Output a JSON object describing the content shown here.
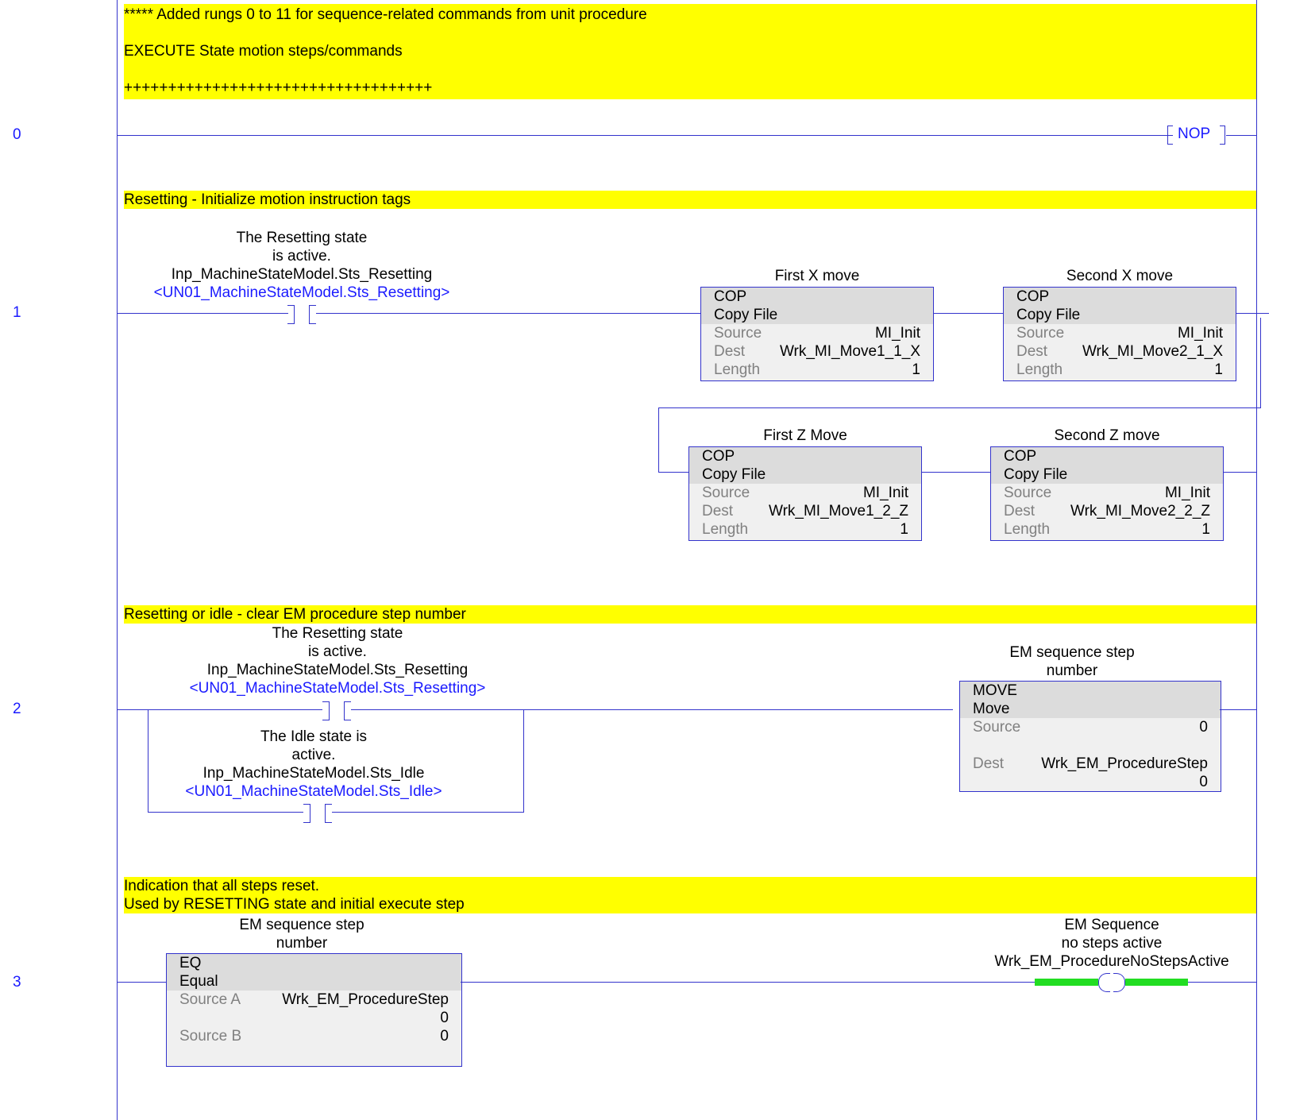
{
  "rungs": [
    {
      "number": "0",
      "comment": [
        "***** Added rungs 0 to 11 for sequence-related commands from unit procedure",
        "",
        "EXECUTE State motion steps/commands",
        "",
        "+++++++++++++++++++++++++++++++++++"
      ],
      "instruction": "NOP"
    },
    {
      "number": "1",
      "comment": [
        "Resetting - Initialize motion instruction tags"
      ],
      "contact": {
        "desc1": "The Resetting state",
        "desc2": "is active.",
        "tag": "Inp_MachineStateModel.Sts_Resetting",
        "alias": "<UN01_MachineStateModel.Sts_Resetting>"
      },
      "cop_blocks": [
        {
          "title": "First X move",
          "mnemonic": "COP",
          "name": "Copy File",
          "source_label": "Source",
          "source": "MI_Init",
          "dest_label": "Dest",
          "dest": "Wrk_MI_Move1_1_X",
          "length_label": "Length",
          "length": "1"
        },
        {
          "title": "Second X move",
          "mnemonic": "COP",
          "name": "Copy File",
          "source_label": "Source",
          "source": "MI_Init",
          "dest_label": "Dest",
          "dest": "Wrk_MI_Move2_1_X",
          "length_label": "Length",
          "length": "1"
        },
        {
          "title": "First Z Move",
          "mnemonic": "COP",
          "name": "Copy File",
          "source_label": "Source",
          "source": "MI_Init",
          "dest_label": "Dest",
          "dest": "Wrk_MI_Move1_2_Z",
          "length_label": "Length",
          "length": "1"
        },
        {
          "title": "Second Z move",
          "mnemonic": "COP",
          "name": "Copy File",
          "source_label": "Source",
          "source": "MI_Init",
          "dest_label": "Dest",
          "dest": "Wrk_MI_Move2_2_Z",
          "length_label": "Length",
          "length": "1"
        }
      ]
    },
    {
      "number": "2",
      "comment": [
        "Resetting or idle - clear EM procedure step number"
      ],
      "contact1": {
        "desc1": "The Resetting state",
        "desc2": "is active.",
        "tag": "Inp_MachineStateModel.Sts_Resetting",
        "alias": "<UN01_MachineStateModel.Sts_Resetting>"
      },
      "contact2": {
        "desc1": "The Idle state is",
        "desc2": "active.",
        "tag": "Inp_MachineStateModel.Sts_Idle",
        "alias": "<UN01_MachineStateModel.Sts_Idle>"
      },
      "move": {
        "title1": "EM sequence step",
        "title2": "number",
        "mnemonic": "MOVE",
        "name": "Move",
        "source_label": "Source",
        "source": "0",
        "dest_label": "Dest",
        "dest": "Wrk_EM_ProcedureStep",
        "dest_value": "0"
      }
    },
    {
      "number": "3",
      "comment": [
        "Indication that all steps reset.",
        "Used by RESETTING state and initial execute step"
      ],
      "eq": {
        "title1": "EM sequence step",
        "title2": "number",
        "mnemonic": "EQ",
        "name": "Equal",
        "source_a_label": "Source A",
        "source_a": "Wrk_EM_ProcedureStep",
        "source_a_value": "0",
        "source_b_label": "Source B",
        "source_b": "0"
      },
      "coil": {
        "desc1": "EM Sequence",
        "desc2": "no steps active",
        "tag": "Wrk_EM_ProcedureNoStepsActive",
        "energized_color": "#22dd22"
      }
    }
  ]
}
